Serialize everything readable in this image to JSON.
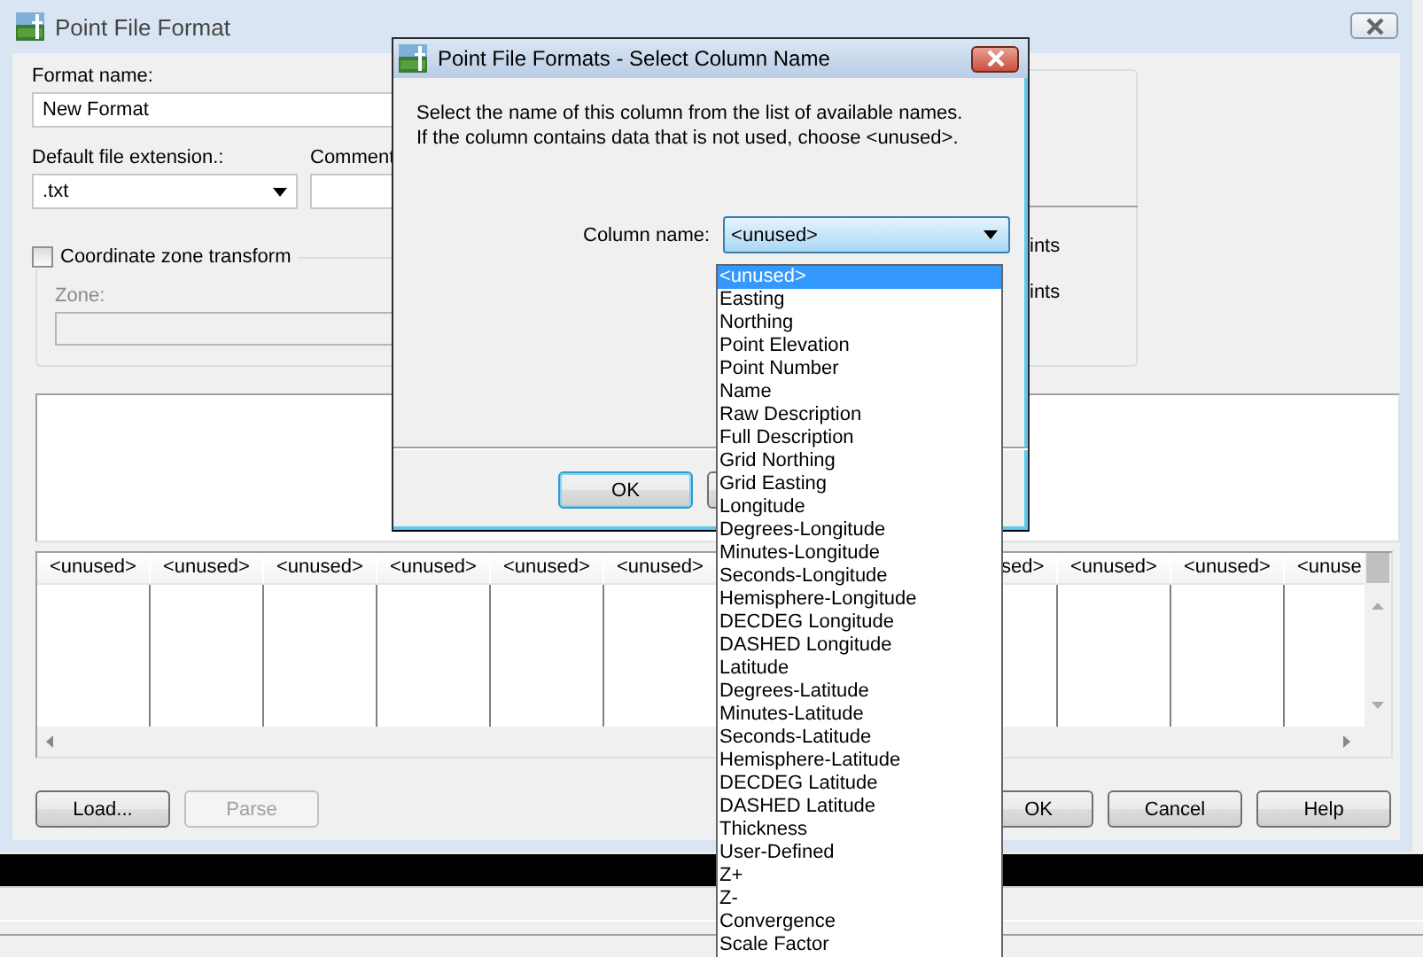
{
  "main_window": {
    "title": "Point File Format"
  },
  "format_name": {
    "label": "Format name:",
    "value": "New Format"
  },
  "default_extension": {
    "label": "Default file extension.:",
    "value": ".txt"
  },
  "comment": {
    "label": "Comment"
  },
  "coordinate_zone_transform": {
    "label": "Coordinate zone transform",
    "checked": false
  },
  "zone": {
    "label": "Zone:",
    "disabled": true
  },
  "option_texts": [
    "ints",
    "ints"
  ],
  "columns_left": [
    "<unused>",
    "<unused>",
    "<unused>",
    "<unused>",
    "<unused>",
    "<unused>"
  ],
  "columns_right": [
    "sed>",
    "<unused>",
    "<unused>",
    "<unuse"
  ],
  "left_buttons": [
    {
      "label": "Load...",
      "disabled": false
    },
    {
      "label": "Parse",
      "disabled": true
    }
  ],
  "right_buttons": [
    {
      "label": "OK",
      "disabled": false
    },
    {
      "label": "Cancel",
      "disabled": false
    },
    {
      "label": "Help",
      "disabled": false
    }
  ],
  "dialog": {
    "title": "Point File Formats - Select Column Name",
    "message": [
      "Select the name of this column from the list of available names.",
      "If the column contains data that is not used, choose <unused>."
    ],
    "column_name_label": "Column name:",
    "column_name_value": "<unused>",
    "ok_button": "OK",
    "list": [
      {
        "label": "<unused>",
        "selected": true
      },
      {
        "label": "Easting",
        "selected": false
      },
      {
        "label": "Northing",
        "selected": false
      },
      {
        "label": "Point Elevation",
        "selected": false
      },
      {
        "label": "Point Number",
        "selected": false
      },
      {
        "label": "Name",
        "selected": false
      },
      {
        "label": "Raw Description",
        "selected": false
      },
      {
        "label": "Full Description",
        "selected": false
      },
      {
        "label": "Grid Northing",
        "selected": false
      },
      {
        "label": "Grid Easting",
        "selected": false
      },
      {
        "label": "Longitude",
        "selected": false
      },
      {
        "label": "Degrees-Longitude",
        "selected": false
      },
      {
        "label": "Minutes-Longitude",
        "selected": false
      },
      {
        "label": "Seconds-Longitude",
        "selected": false
      },
      {
        "label": "Hemisphere-Longitude",
        "selected": false
      },
      {
        "label": "DECDEG Longitude",
        "selected": false
      },
      {
        "label": "DASHED Longitude",
        "selected": false
      },
      {
        "label": "Latitude",
        "selected": false
      },
      {
        "label": "Degrees-Latitude",
        "selected": false
      },
      {
        "label": "Minutes-Latitude",
        "selected": false
      },
      {
        "label": "Seconds-Latitude",
        "selected": false
      },
      {
        "label": "Hemisphere-Latitude",
        "selected": false
      },
      {
        "label": "DECDEG Latitude",
        "selected": false
      },
      {
        "label": "DASHED Latitude",
        "selected": false
      },
      {
        "label": "Thickness",
        "selected": false
      },
      {
        "label": "User-Defined",
        "selected": false
      },
      {
        "label": "Z+",
        "selected": false
      },
      {
        "label": "Z-",
        "selected": false
      },
      {
        "label": "Convergence",
        "selected": false
      },
      {
        "label": "Scale Factor",
        "selected": false
      }
    ]
  }
}
